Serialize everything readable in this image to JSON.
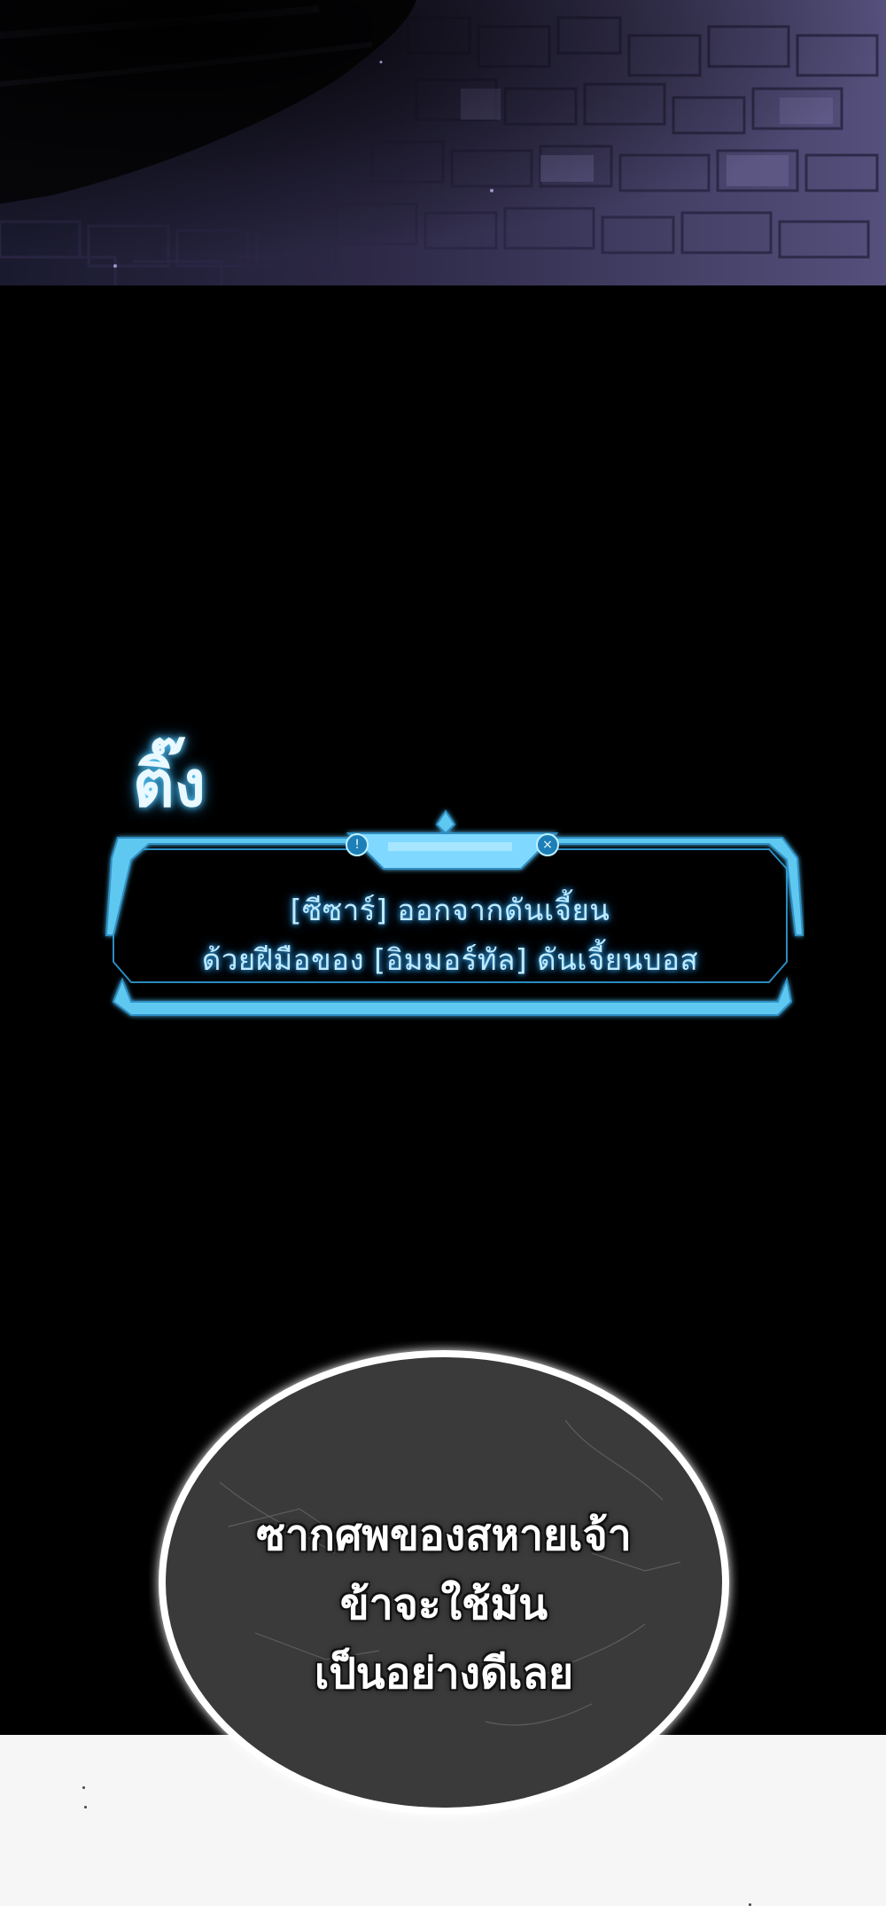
{
  "sound_effect": "ติ๊ง",
  "system_notice": {
    "line1": "[ซีซาร์] ออกจากดันเจี้ยน",
    "line2": "ด้วยฝีมือของ [อิมมอร์ทัล] ดันเจี้ยนบอส",
    "info_icon": "info-icon",
    "close_icon": "close-icon",
    "frame_color": "#5ec8f0",
    "text_color": "#bfeaff"
  },
  "speech_bubble": {
    "line1": "ซากศพของสหายเจ้า",
    "line2": "ข้าจะใช้มัน",
    "line3": "เป็นอย่างดีเลย",
    "fill_color": "#3a3a3a",
    "glow_color": "#ffffff"
  },
  "scene": {
    "wall_color": "#4a4470",
    "background_color": "#000000",
    "bottom_color": "#f6f6f6"
  }
}
